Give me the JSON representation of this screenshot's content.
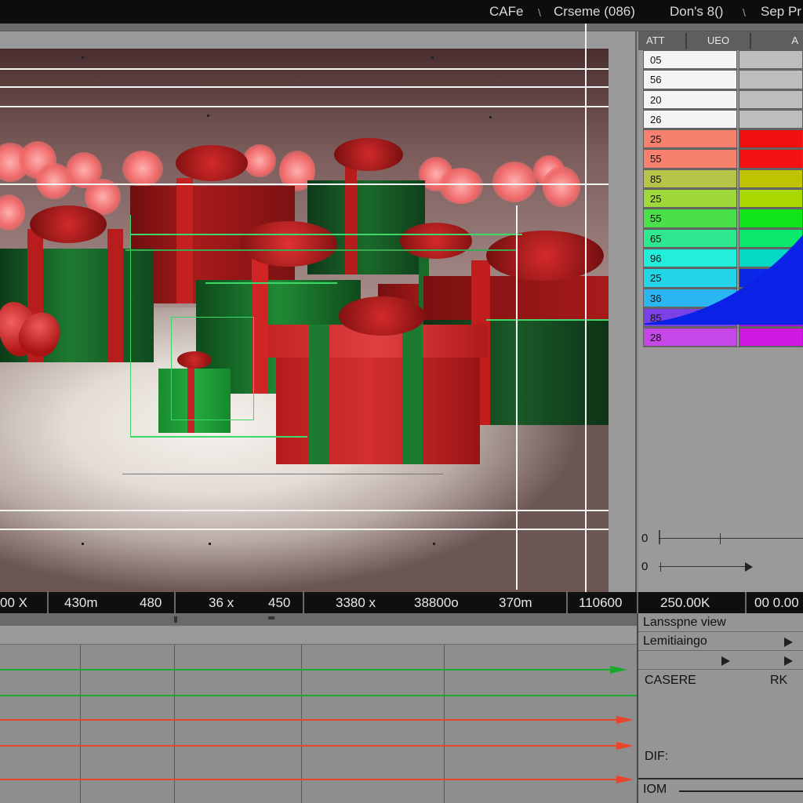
{
  "topbar": {
    "item1": "CAFe",
    "item2": "Crseme (086)",
    "item3": "Don's 8()",
    "item4": "Sep Pr"
  },
  "rpanel": {
    "tab1": "ATT",
    "tab2": "UEO",
    "tab3": "A",
    "rows": [
      {
        "value": "05",
        "color": "#bdbdbd"
      },
      {
        "value": "56",
        "color": "#bdbdbd"
      },
      {
        "value": "20",
        "color": "#bdbdbd"
      },
      {
        "value": "26",
        "color": "#bdbdbd"
      },
      {
        "value": "25",
        "color": "#f20f0f"
      },
      {
        "value": "55",
        "color": "#f41212"
      },
      {
        "value": "85",
        "color": "#bfc400"
      },
      {
        "value": "25",
        "color": "#a8d800"
      },
      {
        "value": "55",
        "color": "#12e41a"
      },
      {
        "value": "65",
        "color": "#0ae86e"
      },
      {
        "value": "96",
        "color": "#05d8c4"
      },
      {
        "value": "25",
        "color": "#0a28e8"
      },
      {
        "value": "36",
        "color": "#0a36e2"
      },
      {
        "value": "85",
        "color": "#a40fe4"
      },
      {
        "value": "28",
        "color": "#d018e0"
      }
    ],
    "row_label_colors": [
      "#f5f5f5",
      "#f5f5f5",
      "#f5f5f5",
      "#f5f5f5",
      "#f7806e",
      "#f7806e",
      "#b6c44a",
      "#9ed83a",
      "#4ae04a",
      "#2ee890",
      "#22eedc",
      "#22d6e8",
      "#2ab6f0",
      "#7a42e6",
      "#c646e8"
    ],
    "slider1_label": "0",
    "slider2_label": "0"
  },
  "ruler": {
    "labels": [
      "00 X",
      "430m",
      "480",
      "36 x",
      "450",
      "3380 x",
      "38800o",
      "370m",
      "110600",
      "250.00K",
      "00 0.00"
    ]
  },
  "props": {
    "row1": "Lansspne view",
    "row2": "Lemitiaingo",
    "row3_left": "CASERE",
    "row3_right": "RK",
    "row4": "DIF:",
    "row5": "IOM"
  }
}
